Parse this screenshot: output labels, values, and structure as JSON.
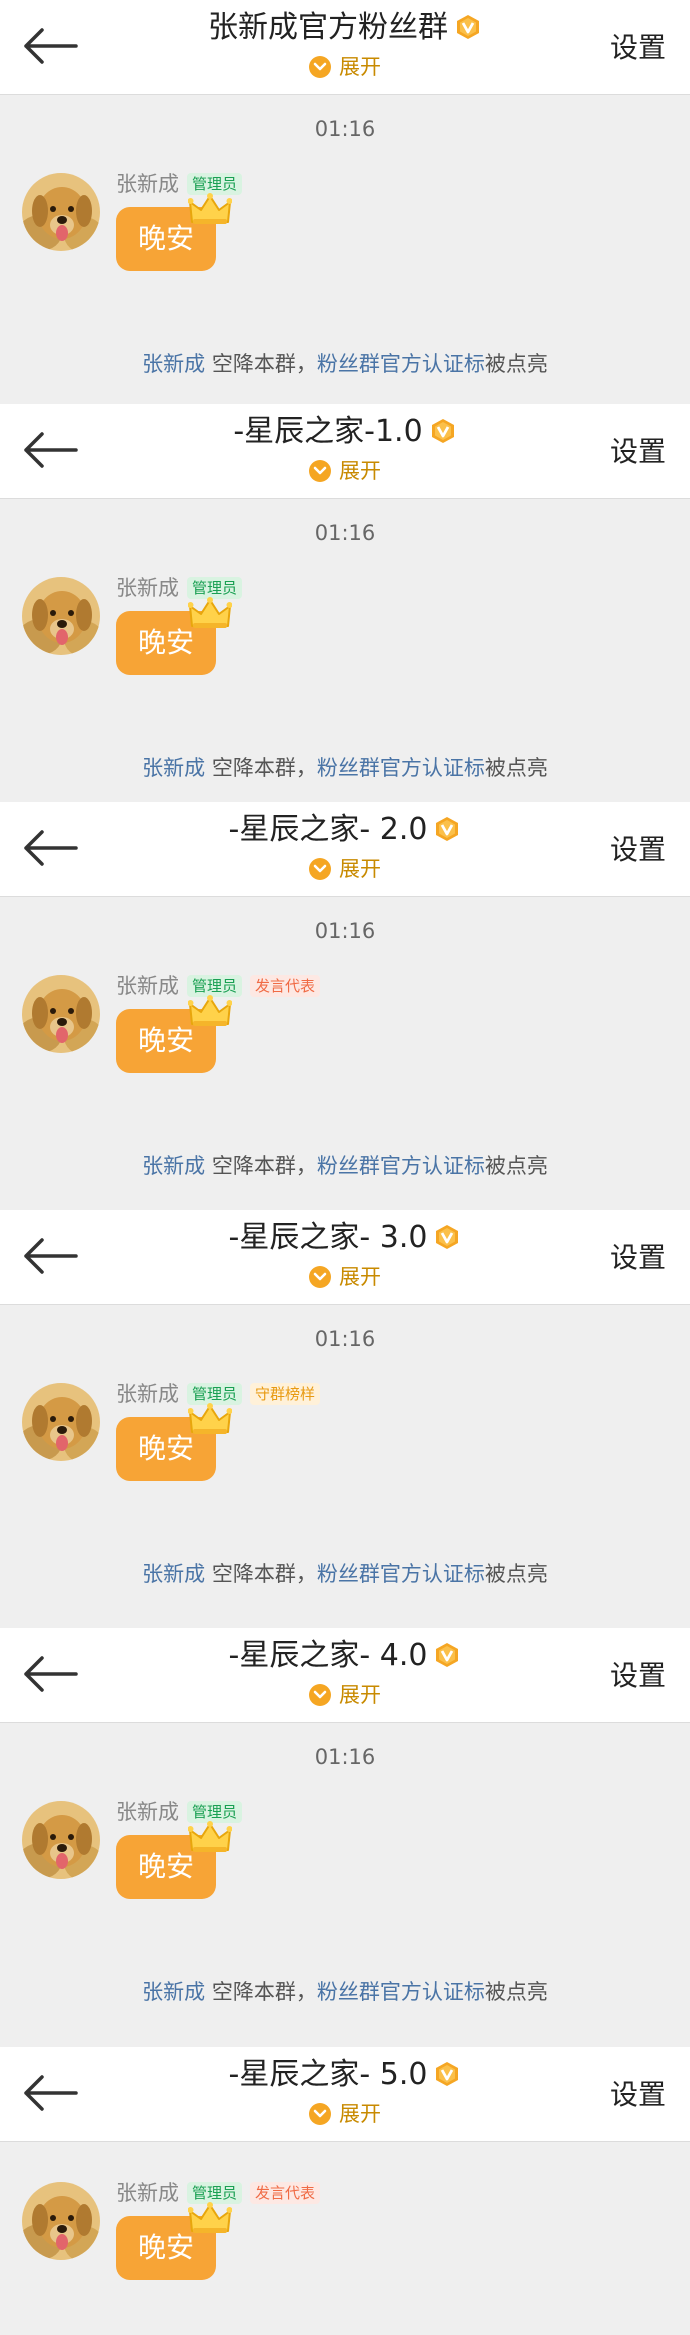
{
  "settings_label": "设置",
  "expand_label": "展开",
  "colors": {
    "accent": "#f7a436",
    "link": "#4a74a6"
  },
  "icons": [
    "back-arrow-icon",
    "verified-v-icon",
    "chevron-down-icon",
    "crown-icon",
    "avatar-dog"
  ],
  "sections": [
    {
      "title": "张新成官方粉丝群",
      "time": "01:16",
      "sender": "张新成",
      "tags": [
        {
          "label": "管理员",
          "kind": "admin"
        }
      ],
      "message": "晚安",
      "sys": {
        "user": "张新成",
        "mid": " 空降本群，",
        "badge": "粉丝群官方认证标",
        "end": "被点亮"
      }
    },
    {
      "title": "-星辰之家-1.0",
      "time": "01:16",
      "sender": "张新成",
      "tags": [
        {
          "label": "管理员",
          "kind": "admin"
        }
      ],
      "message": "晚安",
      "sys": {
        "user": "张新成",
        "mid": " 空降本群，",
        "badge": "粉丝群官方认证标",
        "end": "被点亮"
      }
    },
    {
      "title": "-星辰之家- 2.0",
      "time": "01:16",
      "sender": "张新成",
      "tags": [
        {
          "label": "管理员",
          "kind": "admin"
        },
        {
          "label": "发言代表",
          "kind": "speaker"
        }
      ],
      "message": "晚安",
      "sys": {
        "user": "张新成",
        "mid": " 空降本群，",
        "badge": "粉丝群官方认证标",
        "end": "被点亮"
      }
    },
    {
      "title": "-星辰之家- 3.0",
      "time": "01:16",
      "sender": "张新成",
      "tags": [
        {
          "label": "管理员",
          "kind": "admin"
        },
        {
          "label": "守群榜样",
          "kind": "guard"
        }
      ],
      "message": "晚安",
      "sys": {
        "user": "张新成",
        "mid": " 空降本群，",
        "badge": "粉丝群官方认证标",
        "end": "被点亮"
      }
    },
    {
      "title": "-星辰之家- 4.0",
      "time": "01:16",
      "sender": "张新成",
      "tags": [
        {
          "label": "管理员",
          "kind": "admin"
        }
      ],
      "message": "晚安",
      "sys": {
        "user": "张新成",
        "mid": " 空降本群，",
        "badge": "粉丝群官方认证标",
        "end": "被点亮"
      }
    },
    {
      "title": "-星辰之家- 5.0",
      "time": null,
      "sender": "张新成",
      "tags": [
        {
          "label": "管理员",
          "kind": "admin"
        },
        {
          "label": "发言代表",
          "kind": "speaker"
        }
      ],
      "message": "晚安",
      "sys": null
    }
  ]
}
